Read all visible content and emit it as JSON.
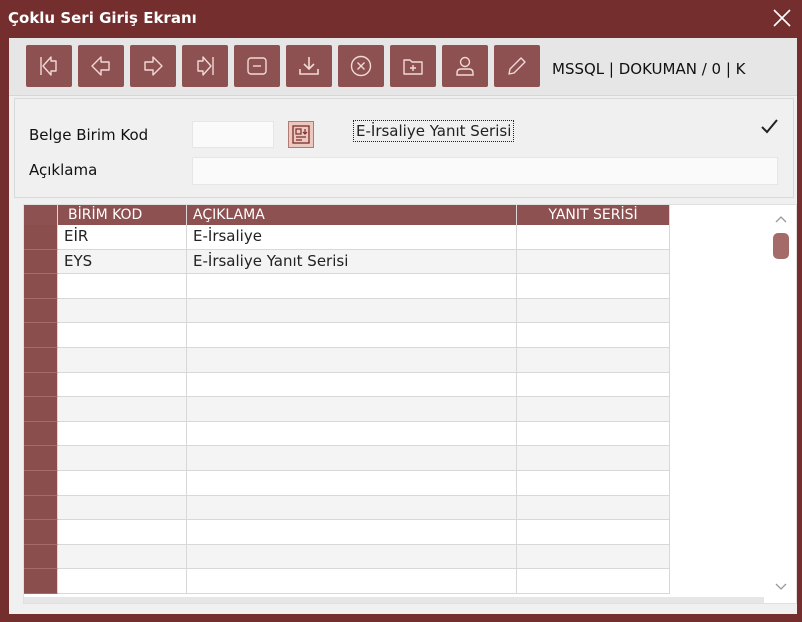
{
  "window": {
    "title": "Çoklu Seri Giriş Ekranı",
    "accent_color": "#742e2d",
    "button_color": "#8c5150"
  },
  "toolbar": {
    "buttons": [
      "first-record-icon",
      "previous-record-icon",
      "next-record-icon",
      "last-record-icon",
      "list-icon",
      "save-icon",
      "delete-icon",
      "new-record-icon",
      "user-icon",
      "edit-icon"
    ],
    "connection": "MSSQL | DOKUMAN / 0 | K"
  },
  "form": {
    "birim_kod_label": "Belge Birim Kod",
    "birim_kod_value": "",
    "yanit_serisi_label": "E-İrsaliye Yanıt Serisi",
    "yanit_serisi_checked": true,
    "aciklama_label": "Açıklama",
    "aciklama_value": ""
  },
  "grid": {
    "columns": [
      "BİRİM KOD",
      "AÇIKLAMA",
      "YANIT SERİSİ"
    ],
    "rows": [
      [
        "EİR",
        "E-İrsaliye",
        ""
      ],
      [
        "EYS",
        "E-İrsaliye Yanıt Serisi",
        ""
      ]
    ],
    "empty_rows": 13
  }
}
